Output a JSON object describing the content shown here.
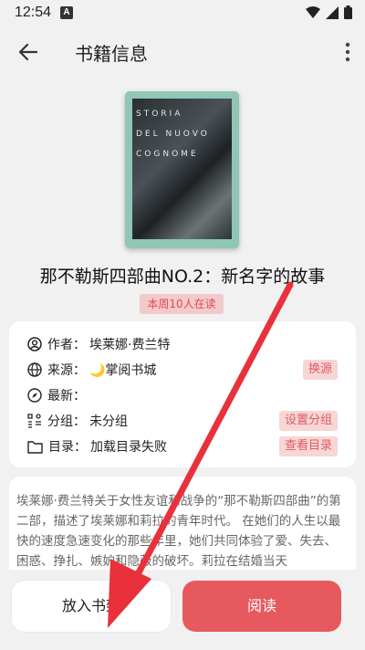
{
  "status_bar": {
    "time": "12:54",
    "notification_icon": "A"
  },
  "app_bar": {
    "title": "书籍信息",
    "back_icon": "arrow-left-icon",
    "more_icon": "more-vert-icon"
  },
  "cover": {
    "lines": [
      "STORIA",
      "DEL NUOVO",
      "COGNOME"
    ],
    "accent": "#8fc6b6"
  },
  "book": {
    "title": "那不勒斯四部曲NO.2：新名字的故事",
    "reading_badge": "本周10人在读"
  },
  "info": {
    "author_label": "作者：",
    "author": "埃莱娜·费兰特",
    "source_label": "来源：",
    "source": "🌙掌阅书城",
    "source_button": "换源",
    "latest_label": "最新：",
    "latest": "",
    "group_label": "分组：",
    "group": "未分组",
    "group_button": "设置分组",
    "toc_label": "目录：",
    "toc": "加载目录失败",
    "toc_button": "查看目录"
  },
  "description": "埃莱娜·费兰特关于女性友谊和战争的“那不勒斯四部曲”的第二部，描述了埃莱娜和莉拉的青年时代。 在她们的人生以最快的速度急速变化的那些年里，她们共同体验了爱、失去、困惑、挣扎、嫉妒和隐蔽的破坏。莉拉在结婚当天",
  "actions": {
    "add_shelf": "放入书架",
    "read": "阅读"
  },
  "colors": {
    "accent": "#e5595f",
    "badge_bg": "#f4c9cc",
    "arrow": "#e8313b"
  }
}
